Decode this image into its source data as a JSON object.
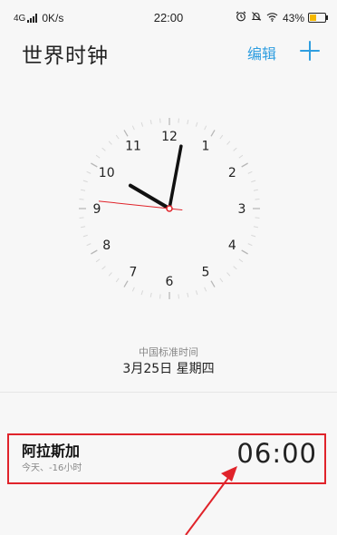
{
  "status_bar": {
    "network": "4G",
    "speed": "0K/s",
    "time": "22:00",
    "battery_percent_label": "43%",
    "battery_level": 0.43,
    "icons": [
      "alarm-icon",
      "mute-icon",
      "wifi-icon",
      "battery-icon"
    ]
  },
  "header": {
    "title": "世界时钟",
    "edit_label": "编辑",
    "add_icon": "plus-icon"
  },
  "clock": {
    "numerals": [
      "12",
      "1",
      "2",
      "3",
      "4",
      "5",
      "6",
      "7",
      "8",
      "9",
      "10",
      "11"
    ],
    "hour": 10,
    "minute": 1,
    "second": 46
  },
  "timezone": {
    "name": "中国标准时间",
    "date": "3月25日 星期四"
  },
  "cities": [
    {
      "name": "阿拉斯加",
      "offset": "今天、-16小时",
      "time": "06:00"
    }
  ],
  "colors": {
    "accent": "#2f9ee0",
    "highlight": "#e0232a",
    "second_hand": "#e0232a"
  }
}
